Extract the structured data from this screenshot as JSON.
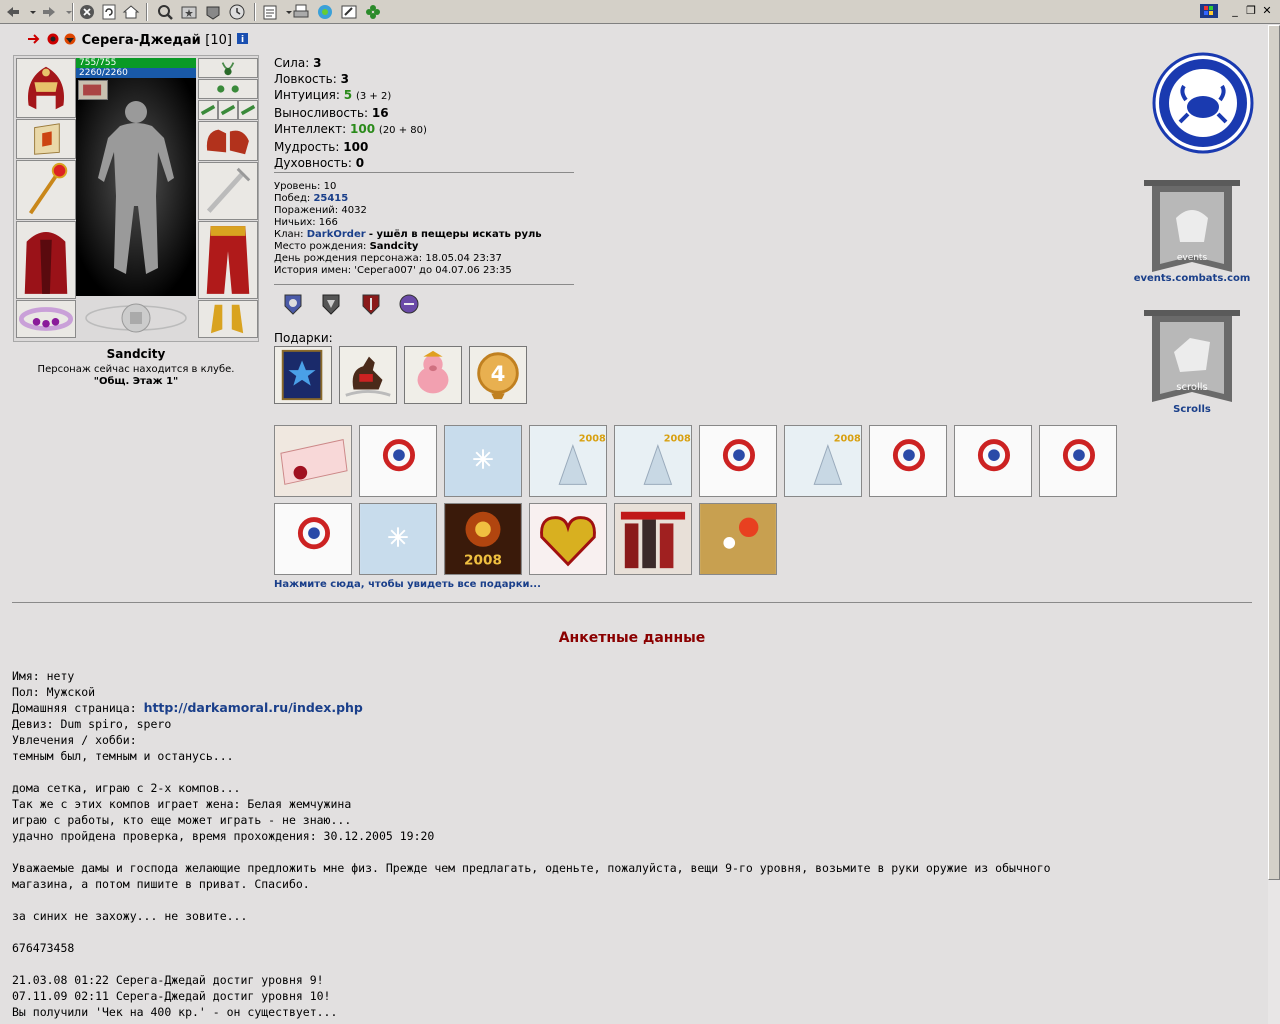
{
  "toolbar": {
    "icons": [
      "back-icon",
      "dropdown-icon",
      "forward-icon",
      "dropdown-icon",
      "stop-icon",
      "refresh-icon",
      "home-icon",
      "search-icon",
      "favorites-icon",
      "media-icon",
      "history-icon",
      "mail-icon",
      "print-icon",
      "messenger-icon",
      "edit-icon",
      "clover-icon"
    ]
  },
  "character": {
    "name": "Серега-Джедай",
    "level": "[10]",
    "hp": "755/755",
    "mana": "2260/2260",
    "city": "Sandcity",
    "location_text": "Персонаж сейчас находится в клубе.",
    "location_place": "\"Общ. Этаж 1\""
  },
  "stats": [
    {
      "label": "Сила:",
      "value": "3",
      "extra": ""
    },
    {
      "label": "Ловкость:",
      "value": "3",
      "extra": ""
    },
    {
      "label": "Интуиция:",
      "value": "5",
      "extra": "(3 + 2)"
    },
    {
      "label": "Выносливость:",
      "value": "16",
      "extra": ""
    },
    {
      "label": "Интеллект:",
      "value": "100",
      "extra": "(20 + 80)"
    },
    {
      "label": "Мудрость:",
      "value": "100",
      "extra": ""
    },
    {
      "label": "Духовность:",
      "value": "0",
      "extra": ""
    }
  ],
  "info": {
    "level_label": "Уровень:",
    "level_value": "10",
    "wins_label": "Побед:",
    "wins_value": "25415",
    "losses_label": "Поражений:",
    "losses_value": "4032",
    "draws_label": "Ничьих:",
    "draws_value": "166",
    "clan_label": "Клан:",
    "clan_name": "DarkOrder",
    "clan_status": "- ушёл в пещеры искать руль",
    "birthplace_label": "Место рождения:",
    "birthplace_value": "Sandcity",
    "birthday": "День рождения персонажа: 18.05.04 23:37",
    "name_history": "История имен: 'Серега007' до 04.07.06 23:35"
  },
  "gifts_title": "Подарки:",
  "see_all_gifts": "Нажмите сюда, чтобы увидеть все подарки...",
  "right": {
    "events_link": "events.combats.com",
    "events_banner_text": "events",
    "scrolls_link": "Scrolls",
    "scrolls_banner_text": "scrolls"
  },
  "anketa": {
    "title": "Анкетные данные",
    "name_line": "Имя: нету",
    "gender_line": "Пол: Мужской",
    "homepage_label": "Домашняя страница: ",
    "homepage_url": "http://darkamoral.ru/index.php",
    "motto_line": "Девиз: Dum spiro, spero",
    "hobby_text": "Увлечения / хобби:\nтемным был, темным и останусь...\n\nдома сетка, играю с 2-х компов...\nТак же с этих компов играет жена: Белая жемчужина\nиграю с работы, кто еще может играть - не знаю...\nудачно пройдена проверка, время прохождения: 30.12.2005 19:20\n\nУважаемые дамы и господа желающие предложить мне физ. Прежде чем предлагать, оденьте, пожалуйста, вещи 9-го уровня, возьмите в руки оружие из обычного\nмагазина, а потом пишите в приват. Спасибо.\n\nза синих не захожу... не зовите...\n\n676473458\n\n21.03.08 01:22 Серега-Джедай достиг уровня 9!\n07.11.09 02:11 Серега-Джедай достиг уровня 10!\nВы получили 'Чек на 400 кр.' - он существует..."
  },
  "colors": {
    "background": "#e2e0e0",
    "link": "#1a3f8a",
    "title_red": "#8a0000",
    "hp_green": "#0a9a26",
    "mana_blue": "#1959a8",
    "stat_green": "#2a8a1a"
  }
}
